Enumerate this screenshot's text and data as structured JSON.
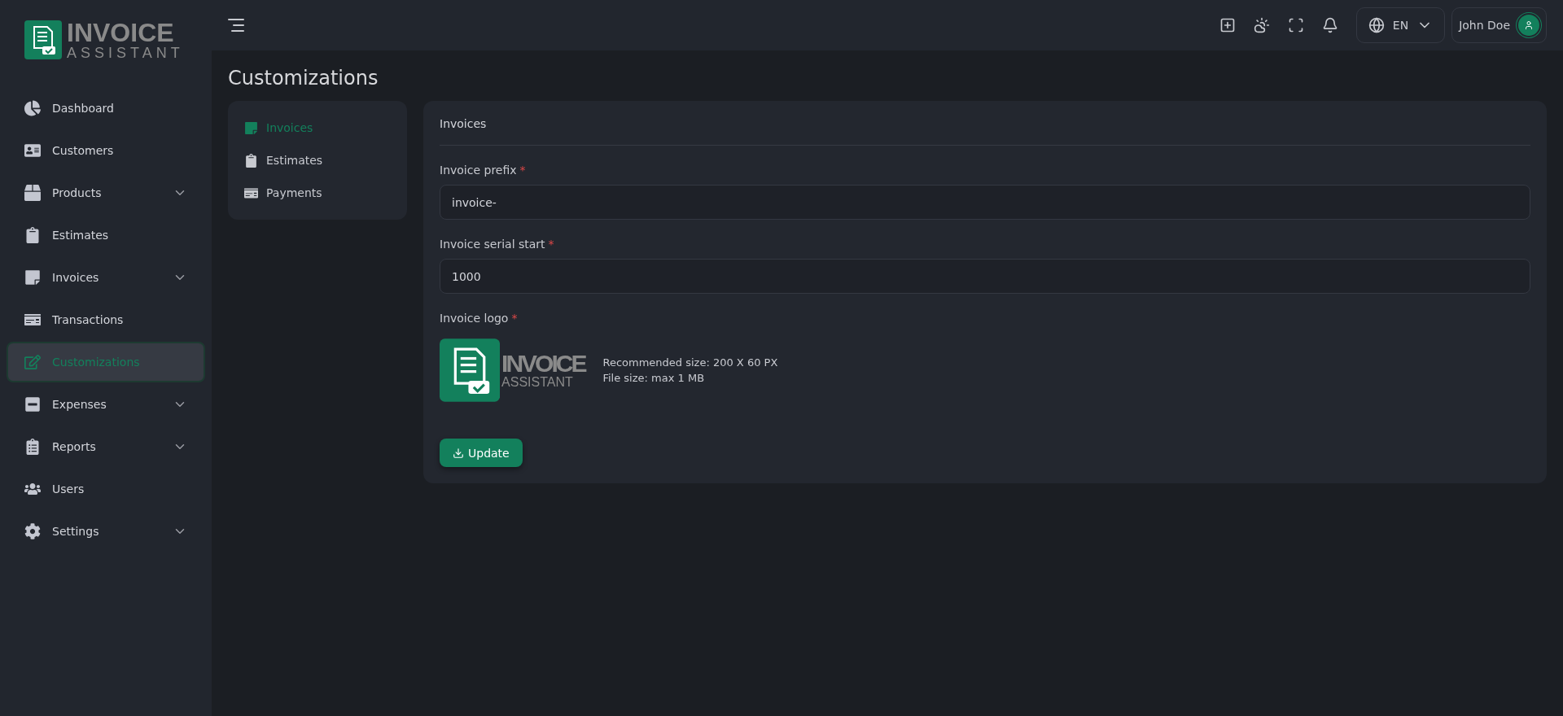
{
  "brand": {
    "line1": "INVOICE",
    "line2": "ASSISTANT"
  },
  "sidebar": {
    "items": [
      {
        "label": "Dashboard",
        "selected": false,
        "has_submenu": false
      },
      {
        "label": "Customers",
        "selected": false,
        "has_submenu": false
      },
      {
        "label": "Products",
        "selected": false,
        "has_submenu": true
      },
      {
        "label": "Estimates",
        "selected": false,
        "has_submenu": false
      },
      {
        "label": "Invoices",
        "selected": false,
        "has_submenu": true
      },
      {
        "label": "Transactions",
        "selected": false,
        "has_submenu": false
      },
      {
        "label": "Customizations",
        "selected": true,
        "has_submenu": false
      },
      {
        "label": "Expenses",
        "selected": false,
        "has_submenu": true
      },
      {
        "label": "Reports",
        "selected": false,
        "has_submenu": true
      },
      {
        "label": "Users",
        "selected": false,
        "has_submenu": false
      },
      {
        "label": "Settings",
        "selected": false,
        "has_submenu": true
      }
    ]
  },
  "header": {
    "language": "EN",
    "user": "John Doe"
  },
  "page_title": "Customizations",
  "sub_nav": [
    {
      "label": "Invoices",
      "selected": true
    },
    {
      "label": "Estimates",
      "selected": false
    },
    {
      "label": "Payments",
      "selected": false
    }
  ],
  "form": {
    "title": "Invoices",
    "fields": [
      {
        "label": "Invoice prefix",
        "required_mark": "*",
        "value": "invoice-"
      },
      {
        "label": "Invoice serial start",
        "required_mark": "*",
        "value": "1000"
      }
    ],
    "logo": {
      "label": "Invoice logo",
      "required_mark": "*",
      "preview": {
        "line1": "INVOICE",
        "line2": "ASSISTANT"
      },
      "hints": [
        "Recommended size: 200 X 60 PX",
        "File size: max 1 MB"
      ]
    },
    "submit": "Update"
  }
}
